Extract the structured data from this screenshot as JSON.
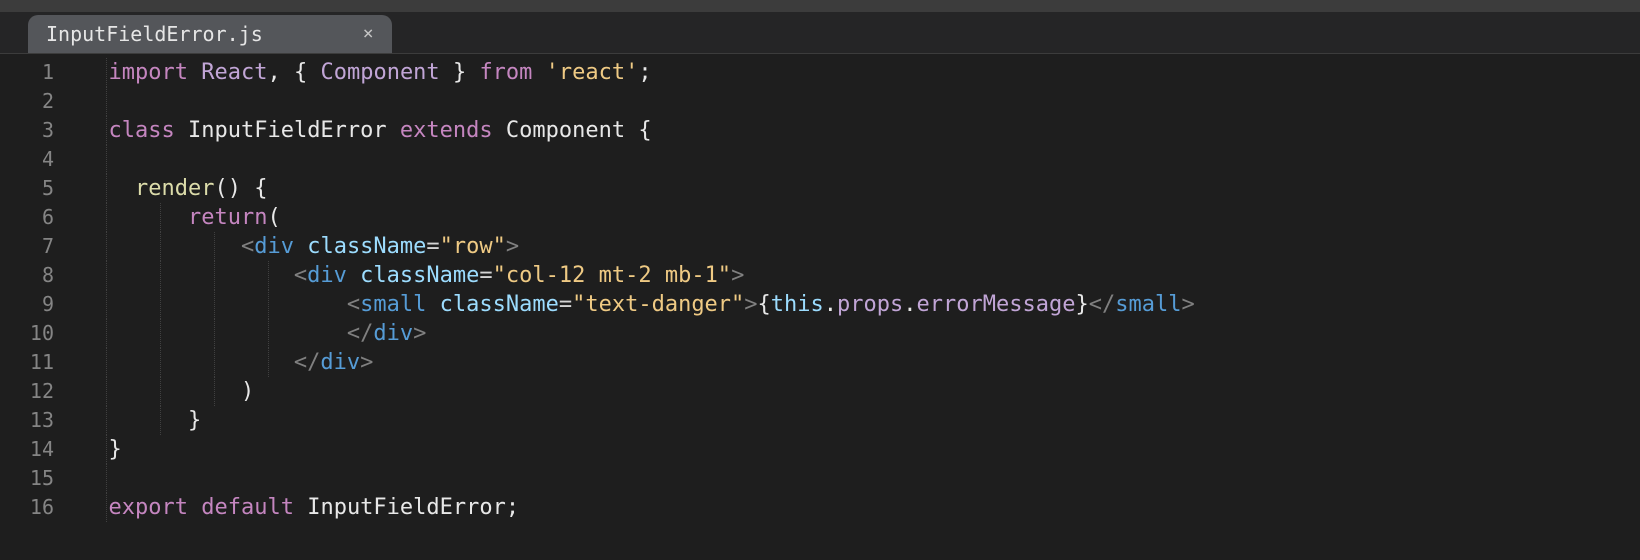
{
  "tab": {
    "filename": "InputFieldError.js",
    "close": "×"
  },
  "gutter": [
    "1",
    "2",
    "3",
    "4",
    "5",
    "6",
    "7",
    "8",
    "9",
    "10",
    "11",
    "12",
    "13",
    "14",
    "15",
    "16"
  ],
  "code": {
    "l1": {
      "kw_import": "import",
      "react": "React",
      "comma": ",",
      "ob": "{",
      "component": "Component",
      "cb": "}",
      "kw_from": "from",
      "str": "'react'",
      "semi": ";"
    },
    "l3": {
      "kw_class": "class",
      "name": "InputFieldError",
      "kw_extends": "extends",
      "component": "Component",
      "ob": "{"
    },
    "l5": {
      "render": "render",
      "paren": "()",
      "ob": "{"
    },
    "l6": {
      "kw_return": "return",
      "op": "("
    },
    "l7": {
      "lt": "<",
      "tag": "div",
      "attr": "className",
      "eq": "=",
      "str": "\"row\"",
      "gt": ">"
    },
    "l8": {
      "lt": "<",
      "tag": "div",
      "attr": "className",
      "eq": "=",
      "str": "\"col-12 mt-2 mb-1\"",
      "gt": ">"
    },
    "l9": {
      "lt": "<",
      "tag": "small",
      "attr": "className",
      "eq": "=",
      "str": "\"text-danger\"",
      "gt": ">",
      "ob": "{",
      "this": "this",
      "dot1": ".",
      "props": "props",
      "dot2": ".",
      "err": "errorMessage",
      "cb": "}",
      "lt2": "</",
      "tag2": "small",
      "gt2": ">"
    },
    "l10": {
      "lt": "</",
      "tag": "div",
      "gt": ">"
    },
    "l11": {
      "lt": "</",
      "tag": "div",
      "gt": ">"
    },
    "l12": {
      "cp": ")"
    },
    "l13": {
      "cb": "}"
    },
    "l14": {
      "cb": "}"
    },
    "l16": {
      "kw_export": "export",
      "kw_default": "default",
      "name": "InputFieldError",
      "semi": ";"
    }
  }
}
